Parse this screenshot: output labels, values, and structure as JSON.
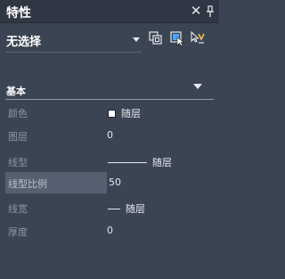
{
  "panel": {
    "title": "特性",
    "close_glyph": "✕"
  },
  "selection": {
    "label": "无选择"
  },
  "icons": [
    "toggle-pickadd-icon",
    "select-objects-icon",
    "quick-select-icon"
  ],
  "section": {
    "title": "基本"
  },
  "properties": [
    {
      "label": "颜色",
      "value": "随层",
      "kind": "color",
      "swatch": "#ffffff"
    },
    {
      "label": "图层",
      "value": "0",
      "kind": "text"
    },
    {
      "label": "线型",
      "value": "随层",
      "kind": "linetype"
    },
    {
      "label": "线型比例",
      "value": "50",
      "kind": "text",
      "active": true
    },
    {
      "label": "线宽",
      "value": "随层",
      "kind": "lineweight"
    },
    {
      "label": "厚度",
      "value": "0",
      "kind": "text"
    }
  ],
  "colors": {
    "panel_bg": "#3b4453",
    "titlebar_bg": "#2f3744",
    "active_row": "#556070",
    "label": "#8d96a4",
    "value": "#e4e7ec"
  }
}
